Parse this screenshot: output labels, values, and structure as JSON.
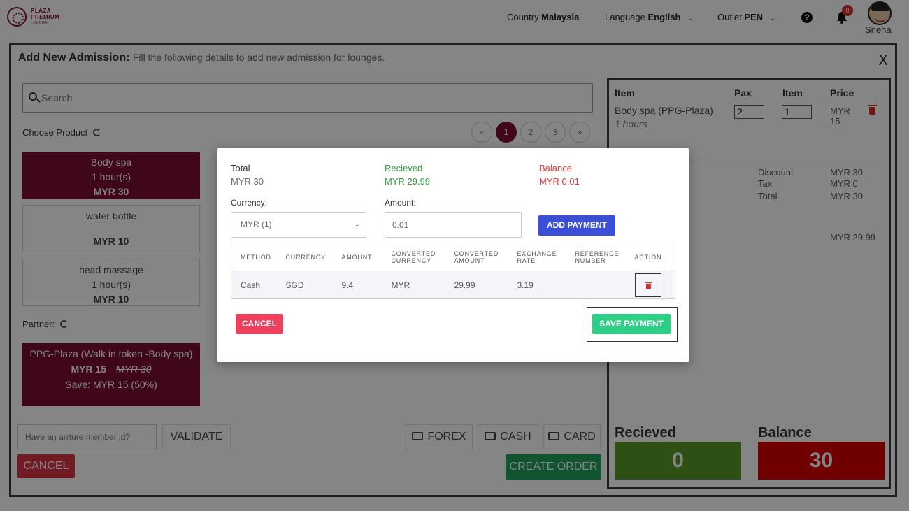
{
  "brand": {
    "line1": "PLAZA",
    "line2": "PREMIUM",
    "line3": "LOUNGE",
    "color": "#8a1538"
  },
  "header": {
    "country_label": "Country",
    "country_value": "Malaysia",
    "language_label": "Language",
    "language_value": "English",
    "outlet_label": "Outlet",
    "outlet_value": "PEN",
    "help_symbol": "?",
    "notifications_count": "0",
    "user_name": "Sneha"
  },
  "admission": {
    "title": "Add New Admission:",
    "subtitle": "Fill the following details to add new admission for lounges.",
    "close_label": "X",
    "search_placeholder": "Search",
    "choose_product_label": "Choose Product",
    "pages": [
      "«",
      "1",
      "2",
      "3",
      "»"
    ],
    "products": [
      {
        "name": "Body spa",
        "duration": "1 hour(s)",
        "price": "MYR 30"
      },
      {
        "name": "water bottle",
        "duration": "",
        "price": "MYR 10"
      },
      {
        "name": "head massage",
        "duration": "1 hour(s)",
        "price": "MYR 10"
      }
    ],
    "partner_label": "Partner:",
    "partner": {
      "name": "PPG-Plaza (Walk in token -Body spa)",
      "price": "MYR 15",
      "original_price": "MYR 30",
      "save": "Save: MYR 15 (50%)"
    },
    "member_placeholder": "Have an arrture member id?",
    "validate_label": "VALIDATE",
    "forex_label": "FOREX",
    "cash_label": "CASH",
    "card_label": "CARD",
    "cancel_label": "CANCEL",
    "create_order_label": "CREATE ORDER"
  },
  "cart": {
    "headers": {
      "item": "Item",
      "pax": "Pax",
      "qty": "Item",
      "price": "Price"
    },
    "items": [
      {
        "name": "Body spa (PPG-Plaza)",
        "sub": "1 hours",
        "pax": "2",
        "qty": "1",
        "price": "MYR 15"
      }
    ],
    "discount_label": "Discount",
    "discount_value": "MYR 30",
    "tax_label": "Tax",
    "tax_value": "MYR 0",
    "total_label": "Total",
    "total_value": "MYR 30",
    "paid_value": "MYR 29.99",
    "received_label": "Recieved",
    "received_value": "0",
    "balance_label": "Balance",
    "balance_value": "30",
    "colors": {
      "received": "#5a9a2a",
      "balance": "#d60000"
    }
  },
  "payment_modal": {
    "total_label": "Total",
    "total_value": "MYR 30",
    "received_label": "Recieved",
    "received_value": "MYR 29.99",
    "balance_label": "Balance",
    "balance_value": "MYR 0.01",
    "currency_label": "Currency:",
    "currency_value": "MYR (1)",
    "amount_label": "Amount:",
    "amount_value": "0.01",
    "add_payment_label": "ADD PAYMENT",
    "table_headers": [
      "METHOD",
      "CURRENCY",
      "AMOUNT",
      "CONVERTED CURRENCY",
      "CONVERTED AMOUNT",
      "EXCHANGE RATE",
      "REFERENCE NUMBER",
      "ACTION"
    ],
    "rows": [
      {
        "method": "Cash",
        "currency": "SGD",
        "amount": "9.4",
        "converted_currency": "MYR",
        "converted_amount": "29.99",
        "exchange_rate": "3.19",
        "reference": ""
      }
    ],
    "cancel_label": "CANCEL",
    "save_label": "SAVE PAYMENT",
    "colors": {
      "received": "#2e9e3a",
      "balance": "#e53935",
      "add_payment": "#3b4ed6",
      "save": "#2bcf85",
      "cancel": "#ef3f5c"
    }
  }
}
